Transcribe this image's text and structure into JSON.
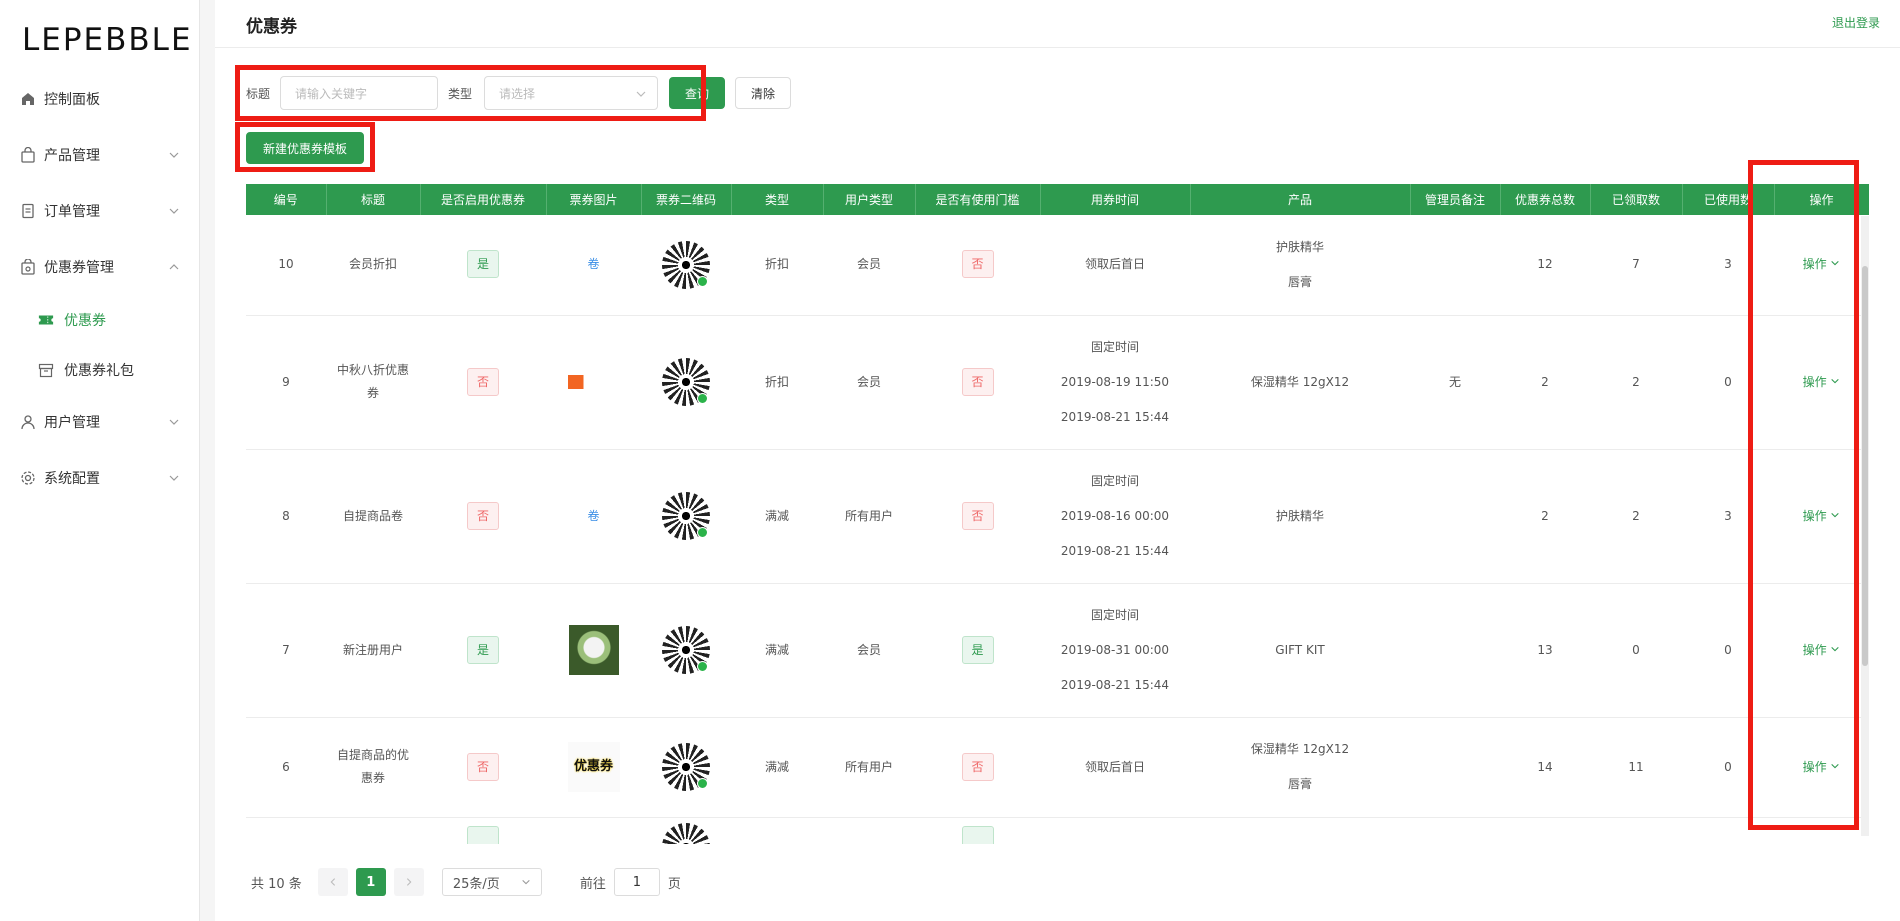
{
  "app": {
    "logo": "LEPEBBLE"
  },
  "sidebar": {
    "items": [
      {
        "label": "控制面板",
        "icon": "home-icon"
      },
      {
        "label": "产品管理",
        "icon": "bag-icon"
      },
      {
        "label": "订单管理",
        "icon": "document-icon"
      },
      {
        "label": "优惠券管理",
        "icon": "coupon-bag-icon"
      },
      {
        "label": "优惠券",
        "icon": "ticket-icon"
      },
      {
        "label": "优惠券礼包",
        "icon": "box-icon"
      },
      {
        "label": "用户管理",
        "icon": "user-icon"
      },
      {
        "label": "系统配置",
        "icon": "gear-icon"
      }
    ]
  },
  "header": {
    "title": "优惠券",
    "logout": "退出登录"
  },
  "filter": {
    "title_label": "标题",
    "title_placeholder": "请输入关键字",
    "type_label": "类型",
    "type_placeholder": "请选择",
    "query_button": "查询",
    "clear_button": "清除"
  },
  "actions": {
    "new_template_button": "新建优惠券模板"
  },
  "table": {
    "columns": [
      "编号",
      "标题",
      "是否启用优惠券",
      "票券图片",
      "票券二维码",
      "类型",
      "用户类型",
      "是否有使用门槛",
      "用券时间",
      "产品",
      "管理员备注",
      "优惠券总数",
      "已领取数",
      "已使用数",
      "操作"
    ],
    "rows": [
      {
        "id": "10",
        "title": [
          "会员折扣"
        ],
        "enabled": "是",
        "image": "卷",
        "type": "折扣",
        "user_type": "会员",
        "threshold": "否",
        "time": [
          "领取后首日"
        ],
        "products": [
          "护肤精华",
          "唇膏"
        ],
        "note": "",
        "total": "12",
        "received": "7",
        "used": "3",
        "op": "操作"
      },
      {
        "id": "9",
        "title": [
          "中秋八折优惠",
          "券"
        ],
        "enabled": "否",
        "image": "banner",
        "type": "折扣",
        "user_type": "会员",
        "threshold": "否",
        "time": [
          "固定时间",
          "2019-08-19 11:50",
          "2019-08-21 15:44"
        ],
        "products": [
          "保湿精华 12gX12"
        ],
        "note": "无",
        "total": "2",
        "received": "2",
        "used": "0",
        "op": "操作"
      },
      {
        "id": "8",
        "title": [
          "自提商品卷"
        ],
        "enabled": "否",
        "image": "卷",
        "type": "满减",
        "user_type": "所有用户",
        "threshold": "否",
        "time": [
          "固定时间",
          "2019-08-16 00:00",
          "2019-08-21 15:44"
        ],
        "products": [
          "护肤精华"
        ],
        "note": "",
        "total": "2",
        "received": "2",
        "used": "3",
        "op": "操作"
      },
      {
        "id": "7",
        "title": [
          "新注册用户"
        ],
        "enabled": "是",
        "image": "flower",
        "type": "满减",
        "user_type": "会员",
        "threshold": "是",
        "time": [
          "固定时间",
          "2019-08-31 00:00",
          "2019-08-21 15:44"
        ],
        "products": [
          "GIFT KIT"
        ],
        "note": "",
        "total": "13",
        "received": "0",
        "used": "0",
        "op": "操作"
      },
      {
        "id": "6",
        "title": [
          "自提商品的优",
          "惠券"
        ],
        "enabled": "否",
        "image": "优惠券",
        "type": "满减",
        "user_type": "所有用户",
        "threshold": "否",
        "time": [
          "领取后首日"
        ],
        "products": [
          "保湿精华 12gX12",
          "唇膏"
        ],
        "note": "",
        "total": "14",
        "received": "11",
        "used": "0",
        "op": "操作"
      }
    ]
  },
  "pager": {
    "total": "共 10 条",
    "current": "1",
    "page_size": "25条/页",
    "goto_label": "前往",
    "goto_value": "1",
    "page_suffix": "页"
  },
  "colors": {
    "accent": "#2e9a4f",
    "highlight_box": "#ee1c14"
  }
}
